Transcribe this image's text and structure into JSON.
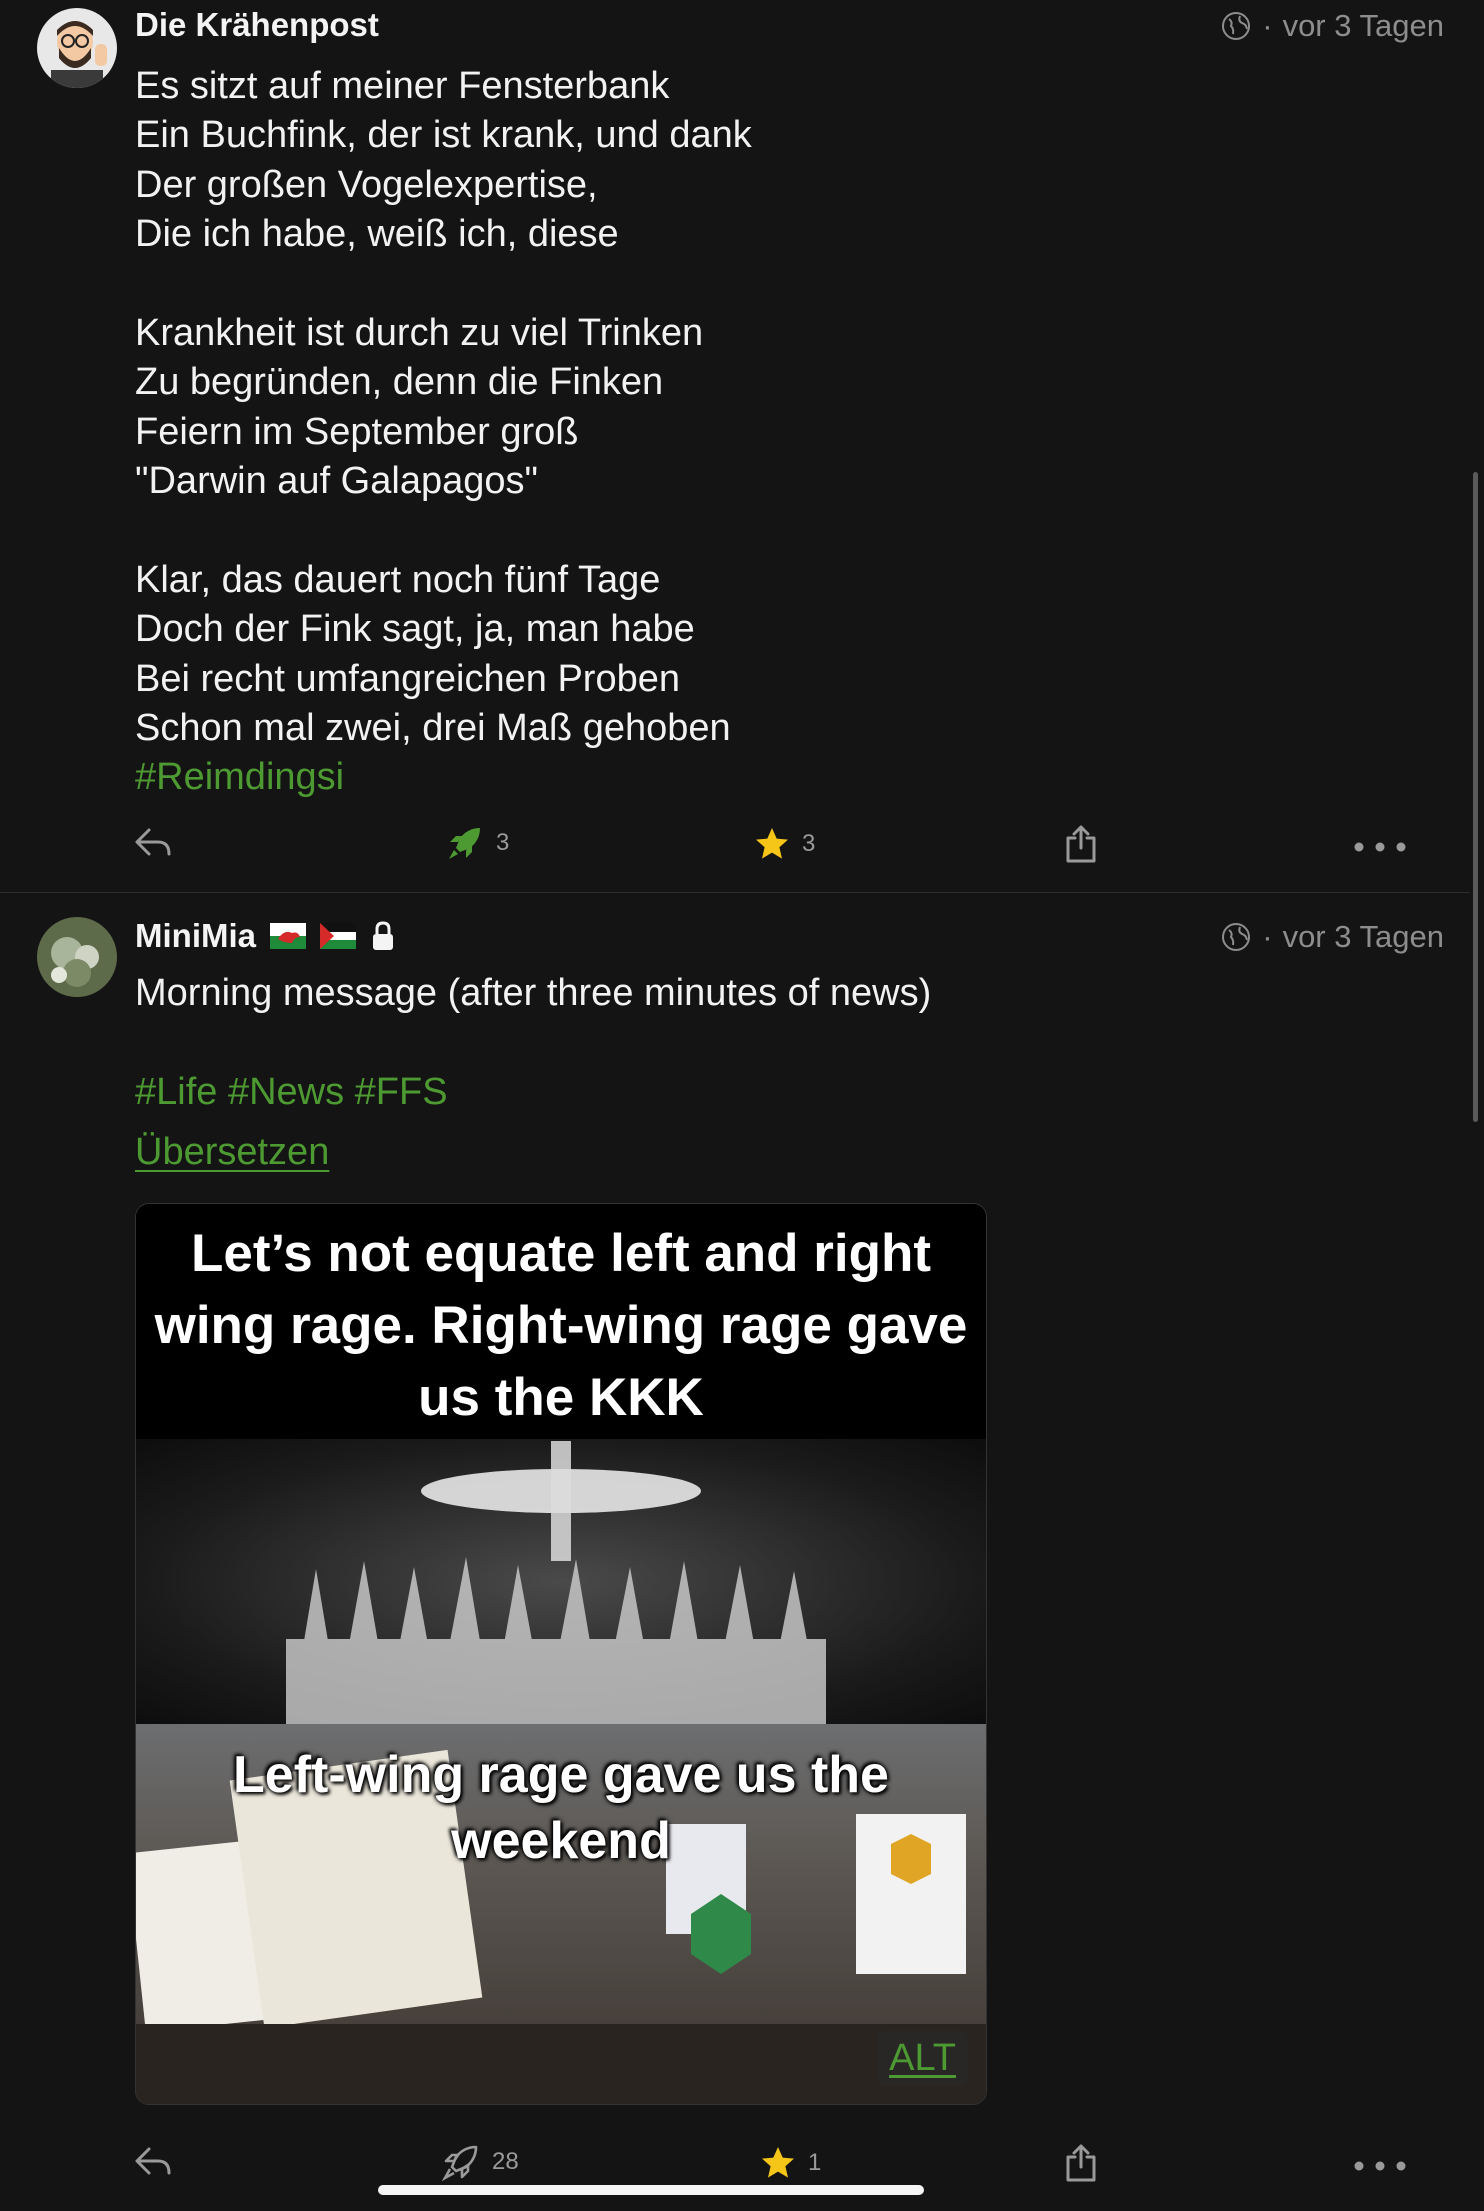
{
  "posts": [
    {
      "author": "Die Krähenpost",
      "time": "vor 3 Tagen",
      "lines": [
        "Es sitzt auf meiner Fensterbank",
        "Ein Buchfink, der ist krank, und dank",
        "Der großen Vogelexpertise,",
        "Die ich habe, weiß ich, diese",
        "",
        "Krankheit ist durch zu viel Trinken",
        "Zu begründen, denn die Finken",
        "Feiern im September groß",
        "\"Darwin auf Galapagos\"",
        "",
        "Klar, das dauert noch fünf Tage",
        "Doch der Fink sagt, ja, man habe",
        "Bei recht umfangreichen Proben",
        "Schon mal zwei, drei Maß gehoben"
      ],
      "hashtags": "#Reimdingsi",
      "boosts": "3",
      "favourites": "3",
      "boosted": true
    },
    {
      "author": "MiniMia",
      "time": "vor 3 Tagen",
      "text": "Morning message (after three minutes of news)",
      "hashtags": "#Life #News #FFS",
      "translate": "Übersetzen",
      "image": {
        "top_text": "Let’s not equate left and right wing rage. Right-wing rage gave us the KKK",
        "bottom_text": "Left-wing rage gave us the weekend",
        "alt_label": "ALT"
      },
      "boosts": "28",
      "favourites": "1",
      "boosted": false
    }
  ],
  "colors": {
    "background": "#141414",
    "accent_green": "#4e9a32",
    "star_yellow": "#f5c518",
    "muted": "#8d8d8d"
  },
  "icons": [
    "globe-icon",
    "reply-icon",
    "boost-icon",
    "star-icon",
    "share-icon",
    "more-icon",
    "lock-icon",
    "wales-flag-icon",
    "palestine-flag-icon"
  ]
}
